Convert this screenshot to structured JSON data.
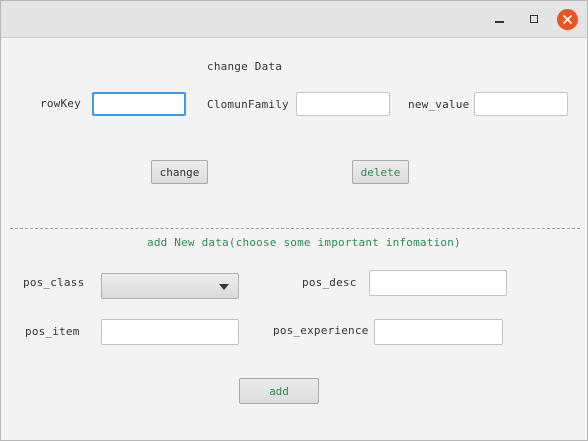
{
  "change_section": {
    "heading": "change Data",
    "rowkey_label": "rowKey",
    "column_family_label": "ClomunFamily",
    "new_value_label": "new_value",
    "rowkey_value": "",
    "column_family_value": "",
    "new_value_value": "",
    "change_label": "change",
    "delete_label": "delete"
  },
  "add_section": {
    "heading": "add New data(choose some important infomation)",
    "pos_class_label": "pos_class",
    "pos_desc_label": "pos_desc",
    "pos_item_label": "pos_item",
    "pos_experience_label": "pos_experience",
    "pos_class_selected": "",
    "pos_desc_value": "",
    "pos_item_value": "",
    "pos_experience_value": "",
    "add_label": "add"
  },
  "colors": {
    "accent_green": "#2e8b57",
    "focus_blue": "#3c9ae8",
    "close_orange": "#e95420"
  }
}
